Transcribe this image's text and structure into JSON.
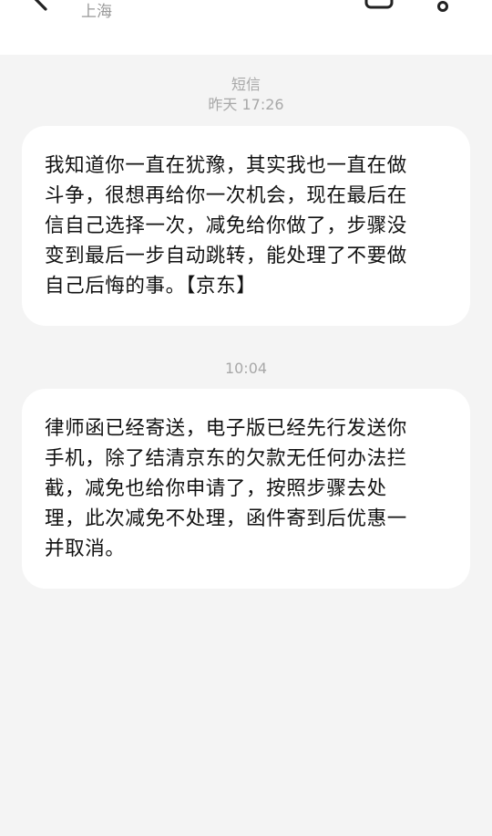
{
  "header": {
    "location": "上海",
    "back_icon": "chevron-left-icon",
    "call_icon": "phone-icon",
    "more_icon": "more-vertical-icon"
  },
  "conversation": {
    "channel_label": "短信",
    "first_timestamp": "昨天 17:26",
    "second_timestamp": "10:04",
    "messages": [
      {
        "lines": [
          "我知道你一直在犹豫，其实我也一直在做",
          "斗争，很想再给你一次机会，现在最后在",
          "信自己选择一次，减免给你做了，步骤没",
          "变到最后一步自动跳转，能处理了不要做",
          "自己后悔的事。【京东】"
        ]
      },
      {
        "lines": [
          "律师函已经寄送，电子版已经先行发送你",
          "手机，除了结清京东的欠款无任何办法拦",
          "截，减免也给你申请了，按照步骤去处",
          "理，此次减免不处理，函件寄到后优惠一",
          "并取消。"
        ]
      }
    ]
  }
}
